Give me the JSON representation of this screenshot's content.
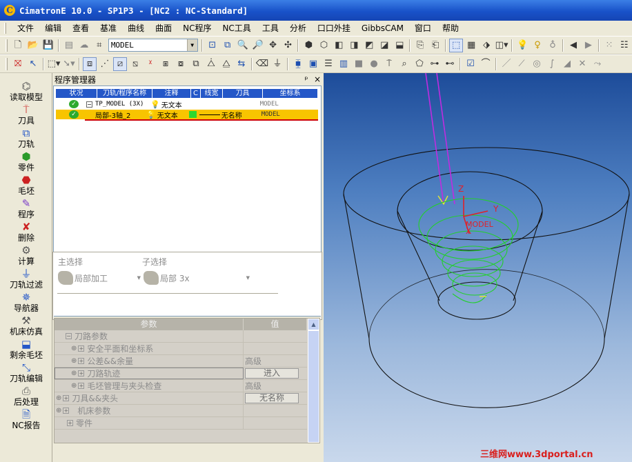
{
  "window": {
    "title": "CimatronE 10.0 - SP1P3 - [NC2 : NC-Standard]",
    "app_icon_letter": "C"
  },
  "menubar": [
    "文件",
    "编辑",
    "查看",
    "基准",
    "曲线",
    "曲面",
    "NC程序",
    "NC工具",
    "工具",
    "分析",
    "口口外挂",
    "GibbsCAM",
    "窗口",
    "帮助"
  ],
  "toolbar": {
    "model_combo_value": "MODEL"
  },
  "sidebar": [
    "读取模型",
    "刀具",
    "刀轨",
    "零件",
    "毛坯",
    "程序",
    "删除",
    "计算",
    "刀轨过滤",
    "导航器",
    "机床仿真",
    "剩余毛坯",
    "刀轨编辑",
    "后处理",
    "NC报告"
  ],
  "program_manager": {
    "title": "程序管理器",
    "pin_label": "ᵖ",
    "close_label": "×",
    "columns": [
      "状况",
      "刀轨/程序名称",
      "注释",
      "C",
      "线宽",
      "刀具",
      "坐标系"
    ],
    "rows": [
      {
        "status": "✓",
        "expander": "−",
        "name": "TP_MODEL (3X)",
        "comment": "无文本",
        "tool": "",
        "ucs": "MODEL"
      },
      {
        "status": "✓",
        "expander": "",
        "name": "局部-3轴_2",
        "comment": "无文本",
        "tool": "无名称",
        "ucs": "MODEL"
      }
    ]
  },
  "selection": {
    "main_label": "主选择",
    "main_value": "局部加工",
    "sub_label": "子选择",
    "sub_value": "局部 3x"
  },
  "properties": {
    "header_param": "参数",
    "header_value": "值",
    "rows": [
      {
        "label": "刀路参数",
        "value": "",
        "indent": 1
      },
      {
        "label": "安全平面和坐标系",
        "value": "",
        "indent": 2
      },
      {
        "label": "公差&&余量",
        "value": "高级",
        "indent": 2
      },
      {
        "label": "刀路轨迹",
        "value": "进入",
        "indent": 2
      },
      {
        "label": "毛坯管理与夹头检查",
        "value": "高级",
        "indent": 2
      },
      {
        "label": "刀具&&夹头",
        "value": "无名称",
        "indent": 0
      },
      {
        "label": "机床参数",
        "value": "",
        "indent": 0
      },
      {
        "label": "零件",
        "value": "",
        "indent": 0
      }
    ]
  },
  "viewport": {
    "axis_z": "Z",
    "axis_y": "Y",
    "axis_x": "X",
    "ucs_label": "MODEL"
  },
  "watermark": "三维网www.3dportal.cn",
  "colors": {
    "title_blue": "#1952c9",
    "selection_yellow": "#f8c400",
    "toolpath_green": "#22d02a",
    "tool_magenta": "#c02ce0",
    "axis_red": "#e0202a",
    "watermark_red": "#d9201e"
  }
}
